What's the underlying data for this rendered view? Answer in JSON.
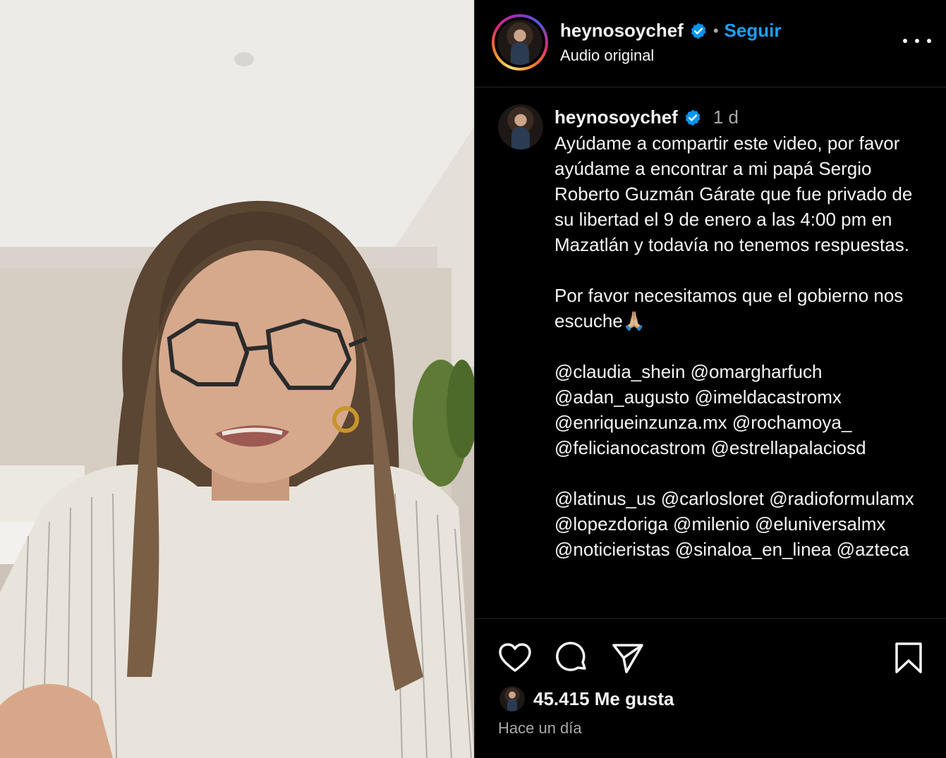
{
  "header": {
    "username": "heynosoychef",
    "separator": "•",
    "follow_label": "Seguir",
    "subtitle": "Audio original",
    "more_icon": "more-horizontal-icon"
  },
  "post": {
    "username": "heynosoychef",
    "time": "1 d",
    "caption": "Ayúdame a compartir este video, por favor ayúdame a encontrar a mi papá Sergio Roberto Guzmán Gárate que fue privado de su libertad el 9 de enero a las 4:00 pm en Mazatlán y todavía no tenemos respuestas.\n\nPor favor necesitamos que el gobierno nos escuche🙏🏼\n\n@claudia_shein @omargharfuch @adan_augusto @imeldacastromx @enriqueinzunza.mx @rochamoya_ @felicianocastrom @estrellapalaciosd\n\n@latinus_us @carlosloret @radioformulamx @lopezdoriga @milenio @eluniversalmx @noticieristas @sinaloa_en_linea @azteca"
  },
  "actions": {
    "like_icon": "heart-icon",
    "comment_icon": "comment-icon",
    "share_icon": "send-icon",
    "save_icon": "bookmark-icon",
    "likes_label": "45.415 Me gusta",
    "time_ago": "Hace un día"
  },
  "colors": {
    "background": "#000000",
    "text": "#f5f5f5",
    "muted": "#a8a8a8",
    "accent": "#1aa0ff",
    "verified": "#0095f6"
  }
}
